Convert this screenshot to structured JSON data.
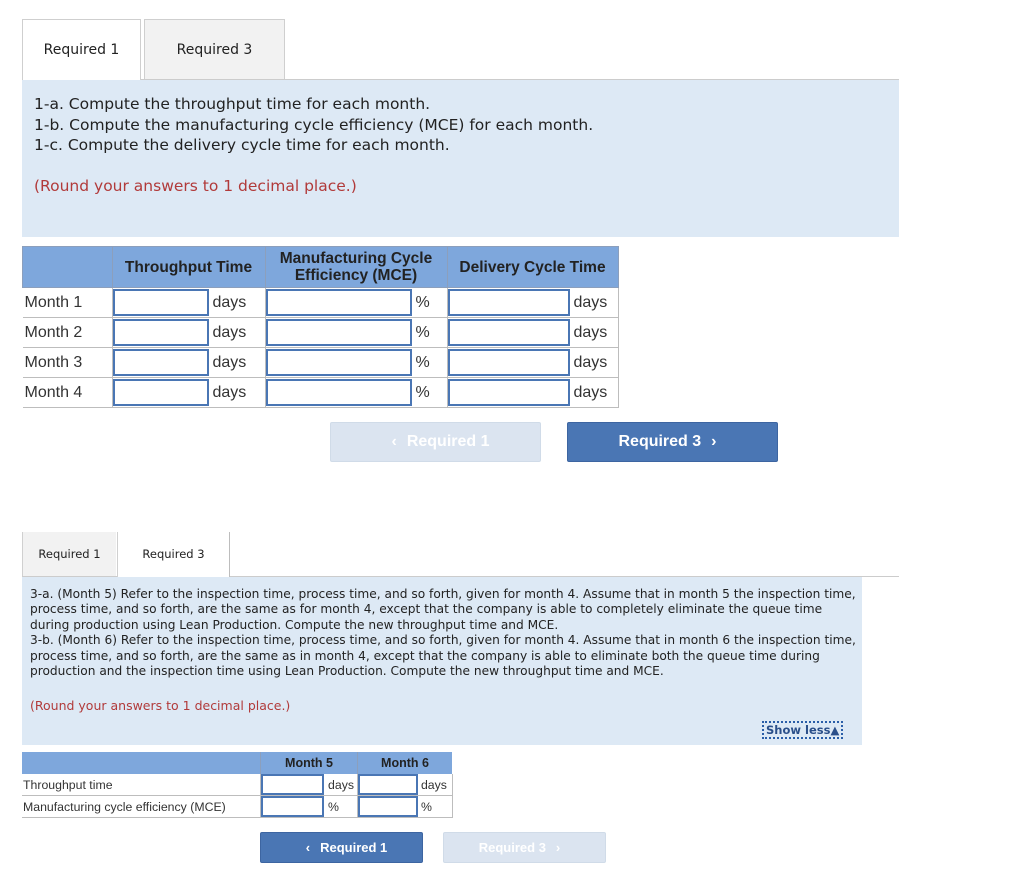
{
  "part1": {
    "tabs": [
      {
        "label": "Required 1",
        "active": true
      },
      {
        "label": "Required 3",
        "active": false
      }
    ],
    "instructions": [
      "1-a. Compute the throughput time for each month.",
      "1-b. Compute the manufacturing cycle efficiency (MCE) for each month.",
      "1-c. Compute the delivery cycle time for each month."
    ],
    "rounding_note": "(Round your answers to 1 decimal place.)",
    "table": {
      "headers": {
        "blank": "",
        "throughput": "Throughput Time",
        "mce_line1": "Manufacturing Cycle",
        "mce_line2": "Efficiency (MCE)",
        "delivery": "Delivery Cycle Time"
      },
      "rows": [
        {
          "label": "Month 1",
          "throughput": "",
          "throughput_unit": "days",
          "mce": "",
          "mce_unit": "%",
          "delivery": "",
          "delivery_unit": "days"
        },
        {
          "label": "Month 2",
          "throughput": "",
          "throughput_unit": "days",
          "mce": "",
          "mce_unit": "%",
          "delivery": "",
          "delivery_unit": "days"
        },
        {
          "label": "Month 3",
          "throughput": "",
          "throughput_unit": "days",
          "mce": "",
          "mce_unit": "%",
          "delivery": "",
          "delivery_unit": "days"
        },
        {
          "label": "Month 4",
          "throughput": "",
          "throughput_unit": "days",
          "mce": "",
          "mce_unit": "%",
          "delivery": "",
          "delivery_unit": "days"
        }
      ]
    },
    "nav": {
      "prev_label": "Required 1",
      "prev_icon": "‹",
      "prev_enabled": false,
      "next_label": "Required 3",
      "next_icon": "›",
      "next_enabled": true
    }
  },
  "part3": {
    "tabs": [
      {
        "label": "Required 1",
        "active": false
      },
      {
        "label": "Required 3",
        "active": true
      }
    ],
    "instructions": [
      "3-a. (Month 5) Refer to the inspection time, process time, and so forth, given for month 4. Assume that in month 5 the inspection time, process time, and so forth, are the same as for month 4, except that the company is able to completely eliminate the queue time during production using Lean Production. Compute the new throughput time and MCE.",
      "3-b. (Month 6) Refer to the inspection time, process time, and so forth, given for month 4. Assume that in month 6 the inspection time, process time, and so forth, are the same as in month 4, except that the company is able to eliminate both the queue time during production and the inspection time using Lean Production. Compute the new throughput time and MCE."
    ],
    "rounding_note": "(Round your answers to 1 decimal place.)",
    "show_less_label": "Show less",
    "show_less_icon": "▲",
    "table": {
      "headers": {
        "blank": "",
        "month5": "Month 5",
        "month6": "Month 6"
      },
      "rows": [
        {
          "label": "Throughput time",
          "m5": "",
          "m5_unit": "days",
          "m6": "",
          "m6_unit": "days"
        },
        {
          "label": "Manufacturing cycle efficiency (MCE)",
          "m5": "",
          "m5_unit": "%",
          "m6": "",
          "m6_unit": "%"
        }
      ]
    },
    "nav": {
      "prev_label": "Required 1",
      "prev_icon": "‹",
      "prev_enabled": true,
      "next_label": "Required 3",
      "next_icon": "›",
      "next_enabled": false
    }
  },
  "colors": {
    "panel_bg": "#dde9f5",
    "header_bg": "#7ea7dc",
    "button_active": "#4a76b4",
    "button_disabled": "#dbe4f0",
    "note_red": "#b13a3a",
    "input_border": "#4a76b4"
  }
}
